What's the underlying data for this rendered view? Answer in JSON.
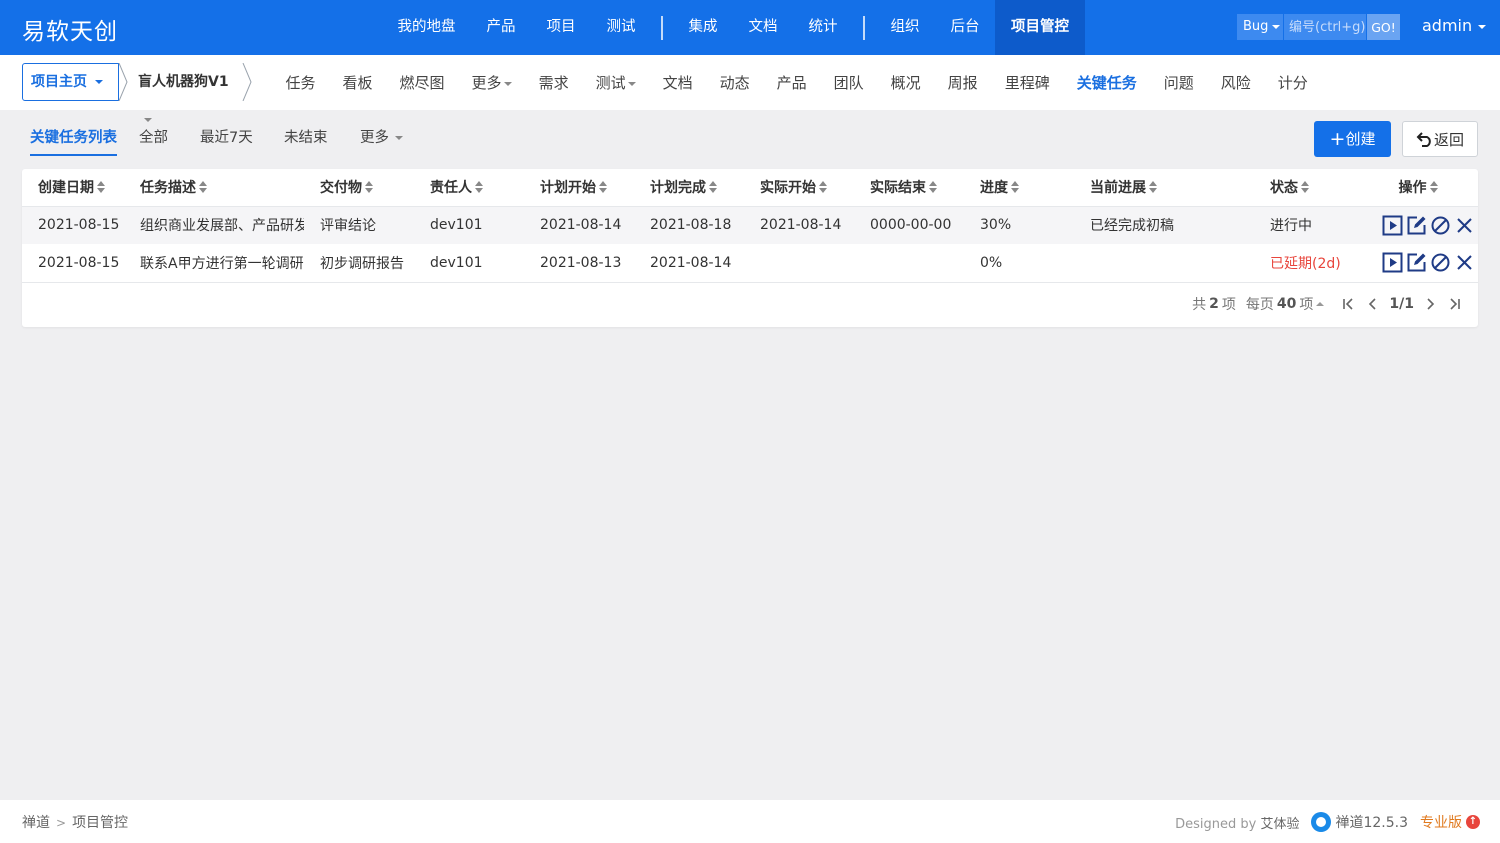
{
  "header": {
    "brand": "易软天创",
    "nav": [
      {
        "label": "我的地盘"
      },
      {
        "label": "产品"
      },
      {
        "label": "项目"
      },
      {
        "label": "测试"
      },
      {
        "label": "集成"
      },
      {
        "label": "文档"
      },
      {
        "label": "统计"
      },
      {
        "label": "组织"
      },
      {
        "label": "后台"
      },
      {
        "label": "项目管控"
      }
    ],
    "search_type": "Bug",
    "search_placeholder": "编号(ctrl+g)",
    "go_label": "GO!",
    "user": "admin"
  },
  "subnav": {
    "home": "项目主页",
    "project": "盲人机器狗V1",
    "items": [
      "任务",
      "看板",
      "燃尽图",
      "更多",
      "需求",
      "测试",
      "文档",
      "动态",
      "产品",
      "团队",
      "概况",
      "周报",
      "里程碑",
      "关键任务",
      "问题",
      "风险",
      "计分"
    ],
    "active": "关键任务"
  },
  "toolbar": {
    "tabs": [
      "关键任务列表",
      "全部",
      "最近7天",
      "未结束",
      "更多"
    ],
    "active": "关键任务列表",
    "create_label": "创建",
    "back_label": "返回"
  },
  "table": {
    "columns": [
      "创建日期",
      "任务描述",
      "交付物",
      "责任人",
      "计划开始",
      "计划完成",
      "实际开始",
      "实际结束",
      "进度",
      "当前进展",
      "状态",
      "操作"
    ],
    "rows": [
      {
        "created": "2021-08-15",
        "desc": "组织商业发展部、产品研发",
        "deliverable": "评审结论",
        "owner": "dev101",
        "plan_start": "2021-08-14",
        "plan_end": "2021-08-18",
        "actual_start": "2021-08-14",
        "actual_end": "0000-00-00",
        "progress": "30%",
        "current": "已经完成初稿",
        "status": "进行中"
      },
      {
        "created": "2021-08-15",
        "desc": "联系A甲方进行第一轮调研",
        "deliverable": "初步调研报告",
        "owner": "dev101",
        "plan_start": "2021-08-13",
        "plan_end": "2021-08-14",
        "actual_start": "",
        "actual_end": "",
        "progress": "0%",
        "current": "",
        "status": "已延期(2d)"
      }
    ],
    "status_colors": {
      "normal": "#333333",
      "delayed": "#e8453c"
    }
  },
  "pager": {
    "total_prefix": "共",
    "total": "2",
    "total_suffix": "项",
    "per_page_prefix": "每页",
    "per_page": "40",
    "per_page_suffix": "项",
    "page": "1/1"
  },
  "footer": {
    "crumb_root": "禅道",
    "crumb_current": "项目管控",
    "designed_by": "Designed by",
    "designer": "艾体验",
    "version": "禅道12.5.3",
    "edition": "专业版"
  },
  "colors": {
    "primary": "#1470e8",
    "active_nav": "#0d5bcb",
    "danger": "#e8453c"
  }
}
